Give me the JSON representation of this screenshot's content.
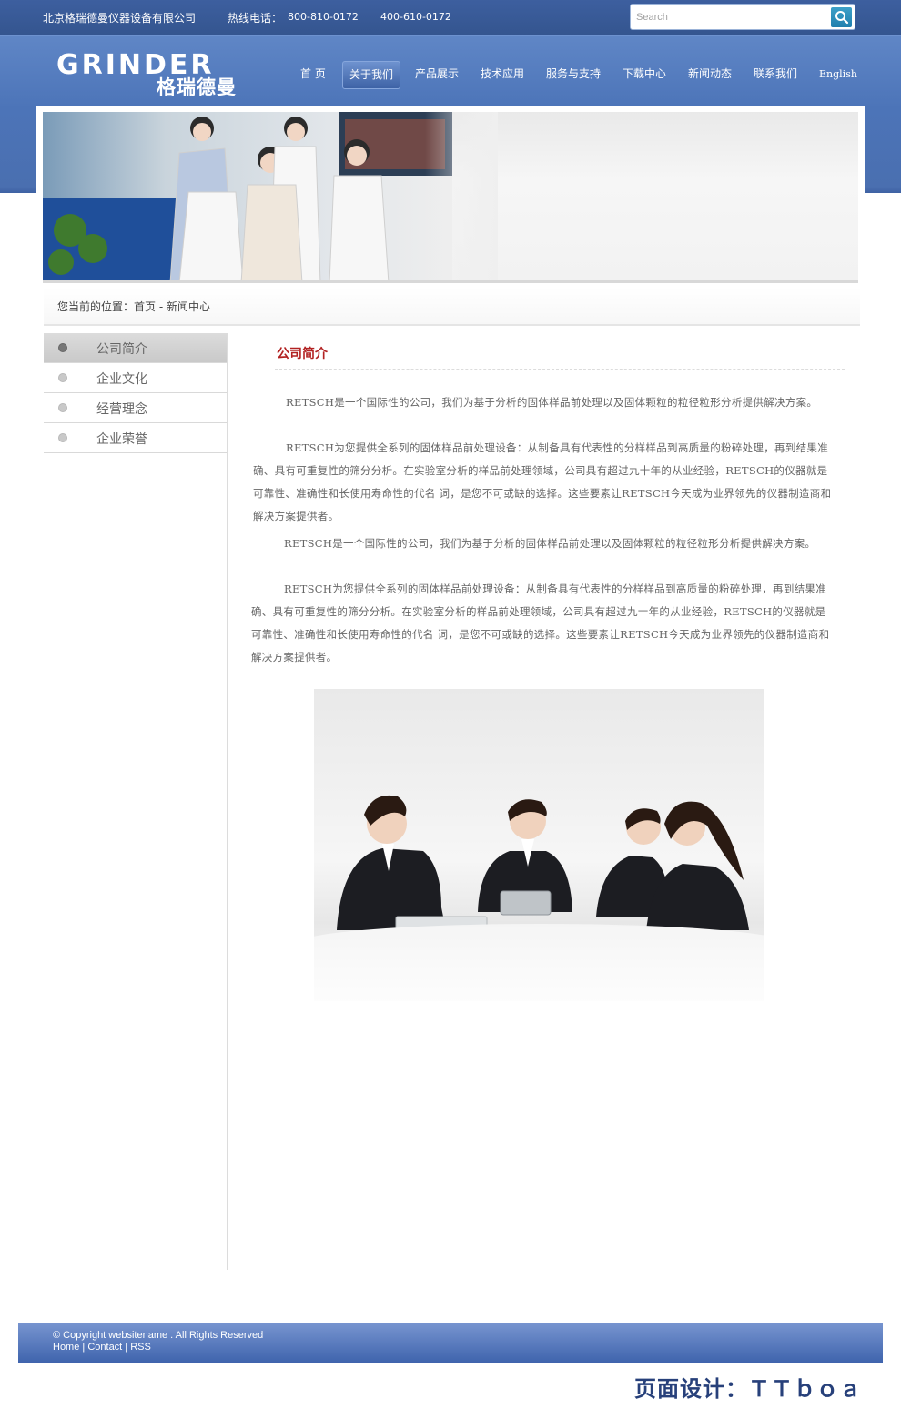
{
  "header": {
    "company_name": "北京格瑞德曼仪器设备有限公司",
    "hotline_label": "热线电话：",
    "hotline_1": "800-810-0172",
    "hotline_2": "400-610-0172",
    "search_placeholder": "Search"
  },
  "logo": {
    "en": "GRINDER",
    "cn": "格瑞德曼"
  },
  "nav": {
    "items": [
      "首 页",
      "关于我们",
      "产品展示",
      "技术应用",
      "服务与支持",
      "下载中心",
      "新闻动态",
      "联系我们",
      "English"
    ],
    "active_index": 1
  },
  "breadcrumb": "您当前的位置：首页 - 新闻中心",
  "sidebar": {
    "items": [
      "公司简介",
      "企业文化",
      "经营理念",
      "企业荣誉"
    ],
    "active_index": 0
  },
  "content": {
    "title": "公司简介",
    "paragraphs": [
      "RETSCH是一个国际性的公司，我们为基于分析的固体样品前处理以及固体颗粒的粒径粒形分析提供解决方案。",
      "RETSCH为您提供全系列的固体样品前处理设备：从制备具有代表性的分样样品到高质量的粉碎处理，再到结果准 确、具有可重复性的筛分分析。在实验室分析的样品前处理领域，公司具有超过九十年的从业经验，RETSCH的仪器就是可靠性、准确性和长使用寿命性的代名 词，是您不可或缺的选择。这些要素让RETSCH今天成为业界领先的仪器制造商和解决方案提供者。",
      "RETSCH是一个国际性的公司，我们为基于分析的固体样品前处理以及固体颗粒的粒径粒形分析提供解决方案。",
      "RETSCH为您提供全系列的固体样品前处理设备：从制备具有代表性的分样样品到高质量的粉碎处理，再到结果准 确、具有可重复性的筛分分析。在实验室分析的样品前处理领域，公司具有超过九十年的从业经验，RETSCH的仪器就是可靠性、准确性和长使用寿命性的代名 词，是您不可或缺的选择。这些要素让RETSCH今天成为业界领先的仪器制造商和解决方案提供者。"
    ]
  },
  "footer": {
    "copyright": "© Copyright websitename . All Rights Reserved",
    "links": [
      "Home",
      "Contact",
      "RSS"
    ],
    "separator": " | "
  },
  "designer_credit": "页面设计：ＴＴｂｏａ",
  "colors": {
    "brand_blue": "#4a70b2",
    "accent_red": "#b22222",
    "footer_blue": "#3f64ad"
  }
}
